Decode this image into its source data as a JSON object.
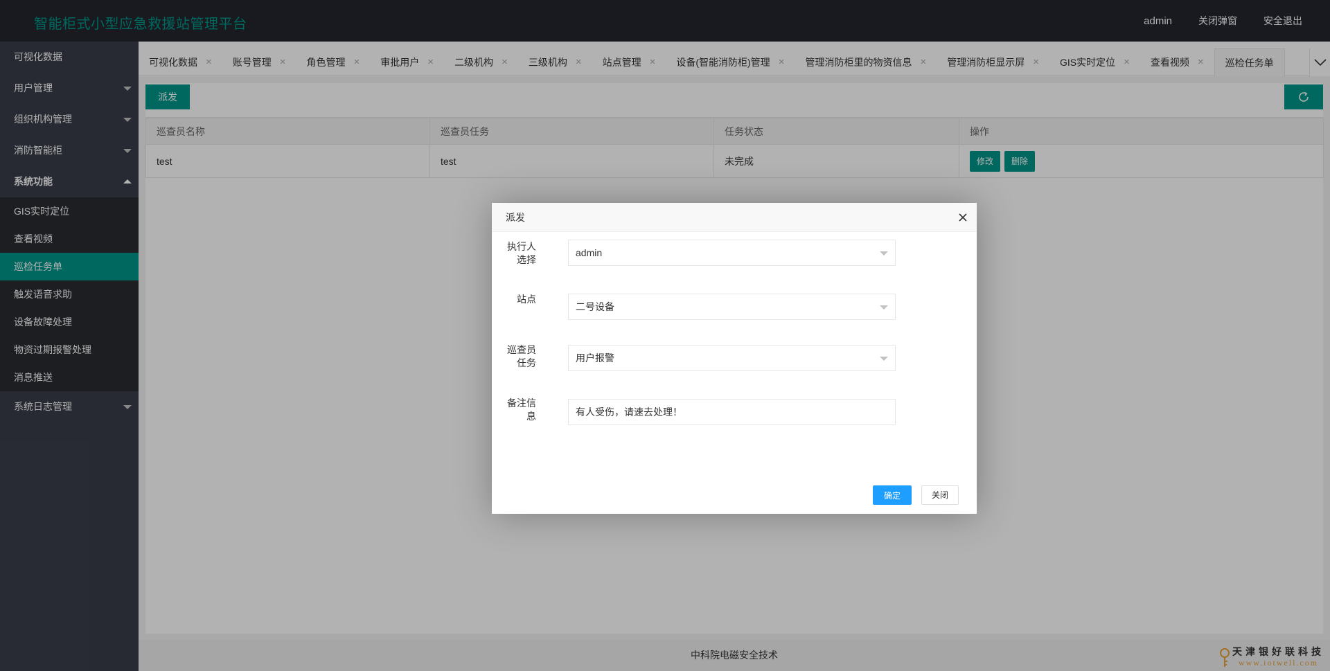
{
  "header": {
    "title": "智能柜式小型应急救援站管理平台",
    "user": "admin",
    "close_popups": "关闭弹窗",
    "logout": "安全退出"
  },
  "sidebar": {
    "items": [
      {
        "label": "可视化数据"
      },
      {
        "label": "用户管理"
      },
      {
        "label": "组织机构管理"
      },
      {
        "label": "消防智能柜"
      },
      {
        "label": "系统功能"
      },
      {
        "label": "系统日志管理"
      }
    ],
    "subitems": [
      {
        "label": "GIS实时定位"
      },
      {
        "label": "查看视频"
      },
      {
        "label": "巡检任务单"
      },
      {
        "label": "触发语音求助"
      },
      {
        "label": "设备故障处理"
      },
      {
        "label": "物资过期报警处理"
      },
      {
        "label": "消息推送"
      }
    ]
  },
  "tabs": [
    {
      "label": "可视化数据"
    },
    {
      "label": "账号管理"
    },
    {
      "label": "角色管理"
    },
    {
      "label": "审批用户"
    },
    {
      "label": "二级机构"
    },
    {
      "label": "三级机构"
    },
    {
      "label": "站点管理"
    },
    {
      "label": "设备(智能消防柜)管理"
    },
    {
      "label": "管理消防柜里的物资信息"
    },
    {
      "label": "管理消防柜显示屏"
    },
    {
      "label": "GIS实时定位"
    },
    {
      "label": "查看视频"
    },
    {
      "label": "巡检任务单"
    }
  ],
  "tab_close_glyph": "×",
  "toolbar": {
    "dispatch": "派发"
  },
  "table": {
    "headers": [
      "巡查员名称",
      "巡查员任务",
      "任务状态",
      "操作"
    ],
    "rows": [
      {
        "name": "test",
        "task": "test",
        "status": "未完成",
        "edit": "修改",
        "delete": "删除"
      }
    ]
  },
  "dialog": {
    "title": "派发",
    "executor": {
      "label_line1": "执行人",
      "label_line2": "选择",
      "value": "admin"
    },
    "site": {
      "label": "站点",
      "value": "二号设备"
    },
    "task": {
      "label_line1": "巡查员",
      "label_line2": "任务",
      "value": "用户报警"
    },
    "remark": {
      "label_line1": "备注信",
      "label_line2": "息",
      "value": "有人受伤，请速去处理！"
    },
    "confirm": "确定",
    "close": "关闭"
  },
  "footer": {
    "text": "中科院电磁安全技术",
    "watermark_name": "天津银好联科技",
    "watermark_url": "www.iotwell.com"
  },
  "colors": {
    "primary": "#009688",
    "header_bg": "#23262e",
    "sidebar_bg": "#393d49",
    "confirm_blue": "#1e9fff"
  }
}
